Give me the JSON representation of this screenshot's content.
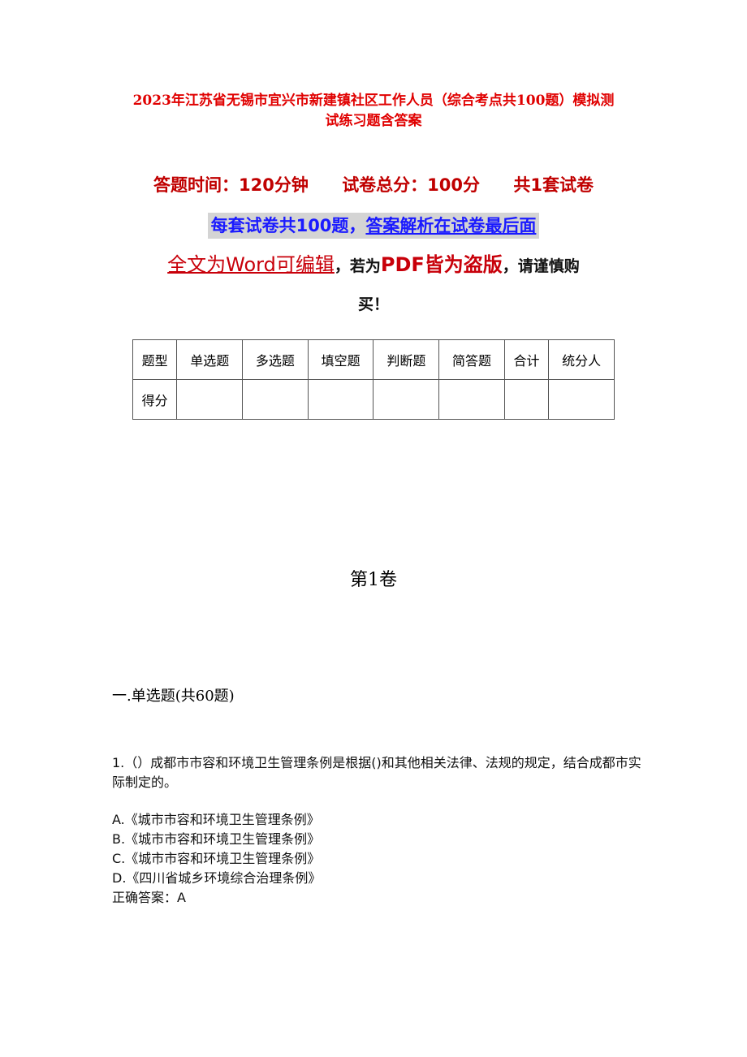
{
  "document": {
    "title_line1": "2023年江苏省无锡市宜兴市新建镇社区工作人员（综合考点共100题）模拟测",
    "title_line2": "试练习题含答案",
    "meta": {
      "time": "答题时间：120分钟",
      "total": "试卷总分：100分",
      "sets": "共1套试卷"
    },
    "notice": {
      "part1": "每套试卷共100题，",
      "part2": "答案解析在试卷最后面"
    },
    "word_line": {
      "part1": "全文为Word可编辑",
      "comma1": "，",
      "part2": "若为",
      "part3": "PDF皆为盗版",
      "part4": "，请谨慎购",
      "part5": "买！"
    },
    "score_table": {
      "headers": [
        "题型",
        "单选题",
        "多选题",
        "填空题",
        "判断题",
        "简答题",
        "合计",
        "统分人"
      ],
      "row_label": "得分"
    },
    "volume": "第1卷",
    "section": "一.单选题(共60题)",
    "question": {
      "text": "1.（）成都市市容和环境卫生管理条例是根据()和其他相关法律、法规的规定，结合成都市实际制定的。",
      "options": [
        "A.《城市市容和环境卫生管理条例》",
        "B.《城市市容和环境卫生管理条例》",
        "C.《城市市容和环境卫生管理条例》",
        "D.《四川省城乡环境综合治理条例》"
      ],
      "answer": "正确答案：A"
    }
  }
}
